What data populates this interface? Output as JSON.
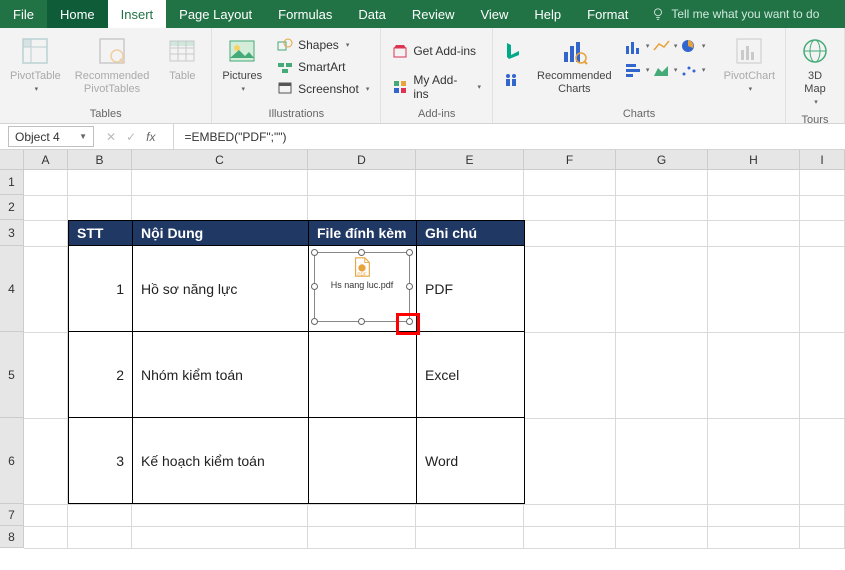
{
  "tabs": {
    "file": "File",
    "home": "Home",
    "insert": "Insert",
    "page_layout": "Page Layout",
    "formulas": "Formulas",
    "data": "Data",
    "review": "Review",
    "view": "View",
    "help": "Help",
    "format": "Format"
  },
  "tell_me": "Tell me what you want to do",
  "ribbon": {
    "tables": {
      "label": "Tables",
      "pivot": "PivotTable",
      "recommended": "Recommended\nPivotTables",
      "table": "Table"
    },
    "illustrations": {
      "label": "Illustrations",
      "pictures": "Pictures",
      "shapes": "Shapes",
      "smartart": "SmartArt",
      "screenshot": "Screenshot"
    },
    "addins": {
      "label": "Add-ins",
      "get": "Get Add-ins",
      "my": "My Add-ins"
    },
    "charts": {
      "label": "Charts",
      "recommended": "Recommended\nCharts",
      "pivotchart": "PivotChart"
    },
    "tours": {
      "label": "Tours",
      "map3d": "3D\nMap"
    }
  },
  "formula_bar": {
    "name_box": "Object 4",
    "formula": "=EMBED(\"PDF\";\"\")"
  },
  "columns": [
    "A",
    "B",
    "C",
    "D",
    "E",
    "F",
    "G",
    "H",
    "I"
  ],
  "col_widths": {
    "A": 44,
    "B": 64,
    "C": 176,
    "D": 108,
    "E": 108,
    "F": 92,
    "G": 92,
    "H": 92,
    "I": 45
  },
  "rows": [
    "1",
    "2",
    "3",
    "4",
    "5",
    "6",
    "7",
    "8"
  ],
  "row_heights": {
    "1": 25,
    "2": 25,
    "3": 26,
    "4": 86,
    "5": 86,
    "6": 86,
    "7": 22,
    "8": 22
  },
  "table": {
    "headers": {
      "stt": "STT",
      "noidung": "Nội Dung",
      "file": "File đính kèm",
      "ghichu": "Ghi chú"
    },
    "rows": [
      {
        "stt": "1",
        "noidung": "Hồ sơ năng lực",
        "ghichu": "PDF"
      },
      {
        "stt": "2",
        "noidung": "Nhóm kiểm toán",
        "ghichu": "Excel"
      },
      {
        "stt": "3",
        "noidung": "Kế hoạch kiểm toán",
        "ghichu": "Word"
      }
    ]
  },
  "embedded_object": {
    "caption": "Hs nang luc.pdf",
    "icon_label": "PDF"
  }
}
